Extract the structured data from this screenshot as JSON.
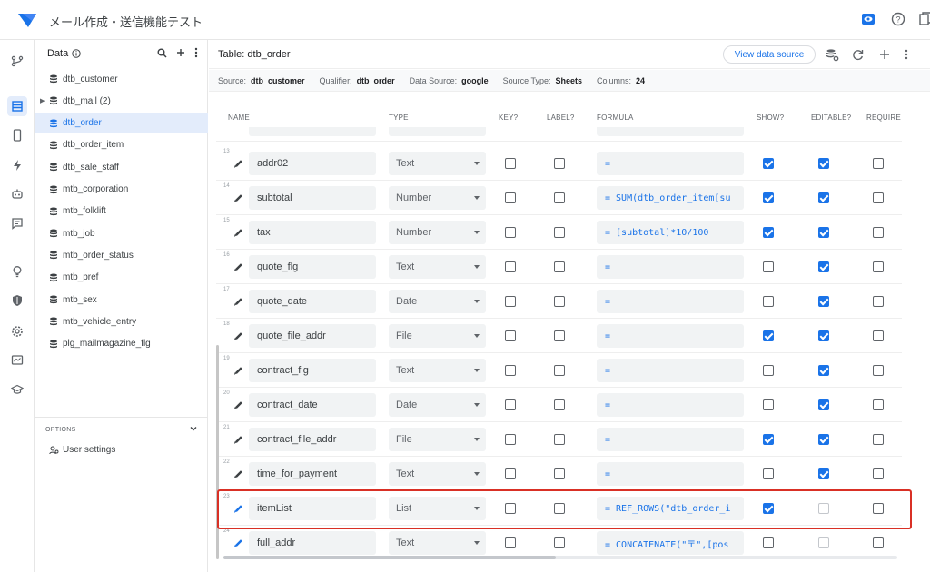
{
  "app": {
    "title": "メール作成・送信機能テスト"
  },
  "colors": {
    "accent": "#1a73e8",
    "highlight": "#d93025",
    "active_bg": "#e3ecfb"
  },
  "top_icons": [
    "preview-icon",
    "help-icon",
    "documents-icon"
  ],
  "rail": [
    "branch-icon",
    "data-icon",
    "mobile-icon",
    "automation-icon",
    "bot-icon",
    "chat-icon",
    "bulb-icon",
    "security-icon",
    "settings-icon",
    "monitor-icon",
    "learn-icon"
  ],
  "sidebar": {
    "title": "Data",
    "tables": [
      {
        "label": "dtb_customer"
      },
      {
        "label": "dtb_mail (2)"
      },
      {
        "label": "dtb_order"
      },
      {
        "label": "dtb_order_item"
      },
      {
        "label": "dtb_sale_staff"
      },
      {
        "label": "mtb_corporation"
      },
      {
        "label": "mtb_folklift"
      },
      {
        "label": "mtb_job"
      },
      {
        "label": "mtb_order_status"
      },
      {
        "label": "mtb_pref"
      },
      {
        "label": "mtb_sex"
      },
      {
        "label": "mtb_vehicle_entry"
      },
      {
        "label": "plg_mailmagazine_flg"
      }
    ],
    "options_label": "OPTIONS",
    "user_settings": "User settings"
  },
  "main": {
    "title": "Table: dtb_order",
    "view_source": "View data source"
  },
  "info": {
    "source_label": "Source:",
    "source": "dtb_customer",
    "qualifier_label": "Qualifier:",
    "qualifier": "dtb_order",
    "datasource_label": "Data Source:",
    "datasource": "google",
    "sourcetype_label": "Source Type:",
    "sourcetype": "Sheets",
    "columns_label": "Columns:",
    "columns": "24"
  },
  "columns": {
    "name": "NAME",
    "type": "TYPE",
    "key": "KEY?",
    "label": "LABEL?",
    "formula": "FORMULA",
    "show": "SHOW?",
    "editable": "EDITABLE?",
    "require": "REQUIRE"
  },
  "rows": [
    {
      "num": "13",
      "name": "addr02",
      "type": "Text",
      "formula": "=",
      "key": false,
      "label": false,
      "show": true,
      "editable": true,
      "require": false
    },
    {
      "num": "14",
      "name": "subtotal",
      "type": "Number",
      "formula": "= SUM(dtb_order_item[su",
      "key": false,
      "label": false,
      "show": true,
      "editable": true,
      "require": false
    },
    {
      "num": "15",
      "name": "tax",
      "type": "Number",
      "formula": "= [subtotal]*10/100",
      "key": false,
      "label": false,
      "show": true,
      "editable": true,
      "require": false
    },
    {
      "num": "16",
      "name": "quote_flg",
      "type": "Text",
      "formula": "=",
      "key": false,
      "label": false,
      "show": false,
      "editable": true,
      "require": false
    },
    {
      "num": "17",
      "name": "quote_date",
      "type": "Date",
      "formula": "=",
      "key": false,
      "label": false,
      "show": false,
      "editable": true,
      "require": false
    },
    {
      "num": "18",
      "name": "quote_file_addr",
      "type": "File",
      "formula": "=",
      "key": false,
      "label": false,
      "show": true,
      "editable": true,
      "require": false
    },
    {
      "num": "19",
      "name": "contract_flg",
      "type": "Text",
      "formula": "=",
      "key": false,
      "label": false,
      "show": false,
      "editable": true,
      "require": false
    },
    {
      "num": "20",
      "name": "contract_date",
      "type": "Date",
      "formula": "=",
      "key": false,
      "label": false,
      "show": false,
      "editable": true,
      "require": false
    },
    {
      "num": "21",
      "name": "contract_file_addr",
      "type": "File",
      "formula": "=",
      "key": false,
      "label": false,
      "show": true,
      "editable": true,
      "require": false
    },
    {
      "num": "22",
      "name": "time_for_payment",
      "type": "Text",
      "formula": "=",
      "key": false,
      "label": false,
      "show": false,
      "editable": true,
      "require": false
    },
    {
      "num": "23",
      "name": "itemList",
      "type": "List",
      "formula": "= REF_ROWS(\"dtb_order_i",
      "key": false,
      "label": false,
      "show": true,
      "editable": false,
      "require": false
    },
    {
      "num": "24",
      "name": "full_addr",
      "type": "Text",
      "formula": "= CONCATENATE(\"〒\",[pos",
      "key": false,
      "label": false,
      "show": false,
      "editable": false,
      "require": false
    }
  ]
}
